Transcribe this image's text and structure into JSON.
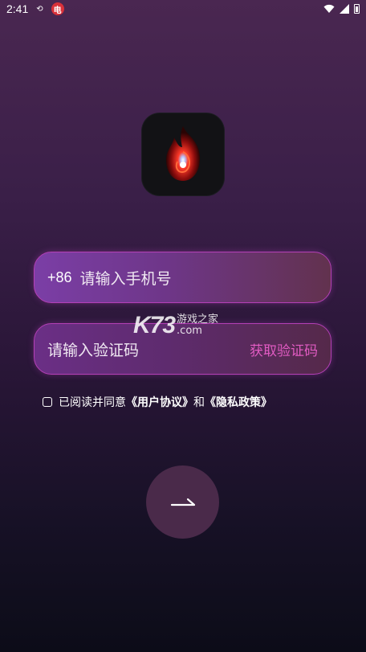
{
  "status_bar": {
    "time": "2:41",
    "notification_badge": "电"
  },
  "phone_field": {
    "prefix": "+86",
    "placeholder": "请输入手机号"
  },
  "code_field": {
    "placeholder": "请输入验证码",
    "get_code_label": "获取验证码"
  },
  "watermark": {
    "brand": "K73",
    "line1": "游戏之家",
    "line2": ".com"
  },
  "agreement": {
    "prefix": "已阅读并同意",
    "user_agreement": "《用户协议》",
    "and": "和",
    "privacy_policy": "《隐私政策》"
  },
  "next_button": {
    "icon": "arrow-right-icon"
  },
  "colors": {
    "field_border": "#b43fb6",
    "get_code": "#e15bc2",
    "background_top": "#4a2751",
    "background_bottom": "#0c0c18"
  }
}
